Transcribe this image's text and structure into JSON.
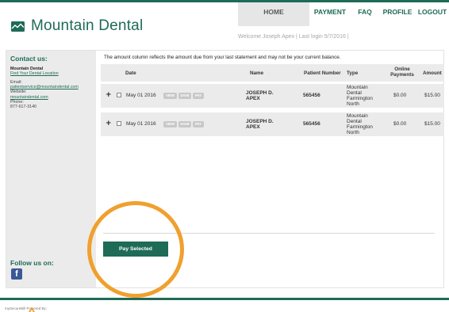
{
  "brand": {
    "name": "Mountain Dental",
    "logo_icon": "mountain-logo-icon"
  },
  "nav": {
    "items": [
      {
        "label": "HOME",
        "active": true
      },
      {
        "label": "PAYMENT",
        "active": false
      },
      {
        "label": "FAQ",
        "active": false
      },
      {
        "label": "PROFILE",
        "active": false
      },
      {
        "label": "LOGOUT",
        "active": false
      }
    ]
  },
  "welcome": "Welcome Joseph Apex | Last login 5/7/2016 |",
  "sidebar": {
    "heading": "Contact us:",
    "practice_name": "Mountain Dental",
    "find_location": "Find Your Dental Location",
    "email_label": "Email:",
    "email": "patientservice@mountaindental.com",
    "website_label": "Website:",
    "website": "mountaindental.com",
    "phone_label": "Phone:",
    "phone": "877-617-3140",
    "follow": "Follow us on:",
    "facebook_glyph": "f"
  },
  "main": {
    "note": "The amount column reflects the amount due from your last statement and may not be your current balance.",
    "columns": {
      "date": "Date",
      "name": "Name",
      "patient_number": "Patient Number",
      "type": "Type",
      "online_payments_1": "Online",
      "online_payments_2": "Payments",
      "amount": "Amount"
    },
    "rows": [
      {
        "expand": "+",
        "date": "May 01 2016",
        "actions": {
          "view": "VIEW",
          "save": "SAVE",
          "pay": "PAY"
        },
        "name_1": "JOSEPH D.",
        "name_2": "APEX",
        "patient_number": "565456",
        "type_1": "Mountain",
        "type_2": "Dental",
        "type_3": "Farmington",
        "type_4": "North",
        "online_payments": "$0.00",
        "amount": "$15.00"
      },
      {
        "expand": "+",
        "date": "May 01 2016",
        "actions": {
          "view": "VIEW",
          "save": "SAVE",
          "pay": "PAY"
        },
        "name_1": "JOSEPH D.",
        "name_2": "APEX",
        "patient_number": "565456",
        "type_1": "Mountain",
        "type_2": "Dental",
        "type_3": "Farmington",
        "type_4": "North",
        "online_payments": "$0.00",
        "amount": "$15.00"
      }
    ],
    "pay_selected": "Pay Selected"
  },
  "footer": {
    "powered_by": "mySecureBill Powered By:"
  },
  "colors": {
    "brand_green": "#1e6b57",
    "highlight_orange": "#f0a02e",
    "facebook_blue": "#3b5998"
  }
}
